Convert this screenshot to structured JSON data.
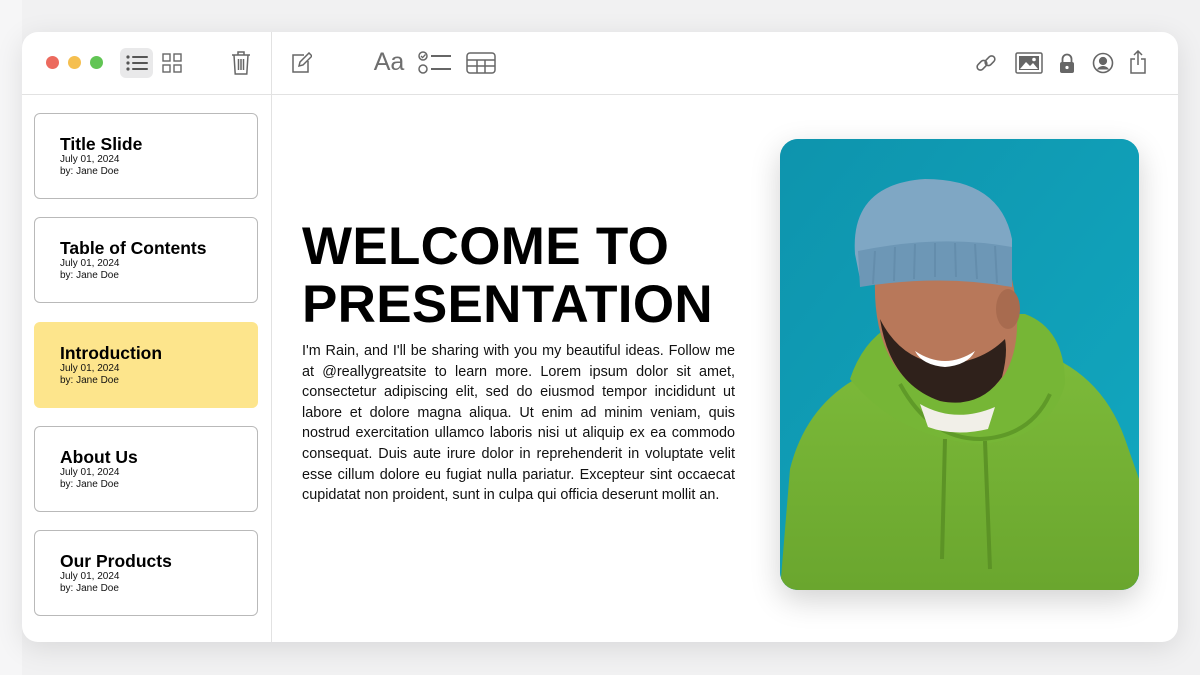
{
  "toolbar": {
    "traffic_lights": {
      "close": "#ec6a5e",
      "minimize": "#f5bf4f",
      "zoom": "#61c554"
    },
    "left_icons": [
      "list-view-icon",
      "grid-view-icon",
      "trash-icon"
    ],
    "edit_icons": [
      "compose-icon",
      "font-format-icon",
      "checklist-icon",
      "table-icon"
    ],
    "font_label": "Aa",
    "right_icons": [
      "link-icon",
      "image-icon",
      "lock-icon",
      "account-icon",
      "share-icon"
    ]
  },
  "sidebar": {
    "items": [
      {
        "title": "Title Slide",
        "date": "July 01, 2024",
        "author": "by: Jane Doe",
        "active": false
      },
      {
        "title": "Table of Contents",
        "date": "July 01, 2024",
        "author": "by: Jane Doe",
        "active": false
      },
      {
        "title": "Introduction",
        "date": "July 01, 2024",
        "author": "by: Jane Doe",
        "active": true
      },
      {
        "title": "About Us",
        "date": "July 01, 2024",
        "author": "by: Jane Doe",
        "active": false
      },
      {
        "title": "Our Products",
        "date": "July 01, 2024",
        "author": "by: Jane Doe",
        "active": false
      }
    ],
    "active_color": "#fde58c"
  },
  "main": {
    "title_line1": "WELCOME TO",
    "title_line2": "PRESENTATION",
    "body": "I'm Rain, and I'll be sharing with you my beautiful ideas. Follow me at @reallygreatsite to learn more. Lorem ipsum dolor sit amet, consectetur adipiscing elit, sed do eiusmod tempor incididunt ut labore et dolore magna aliqua. Ut enim ad minim veniam, quis nostrud exercitation ullamco laboris nisi ut aliquip ex ea commodo consequat. Duis aute irure dolor in reprehenderit in voluptate velit esse cillum dolore eu fugiat nulla pariatur. Excepteur sint occaecat cupidatat non proident, sunt in culpa qui officia deserunt mollit an.",
    "photo_background": "#0f9db4"
  }
}
